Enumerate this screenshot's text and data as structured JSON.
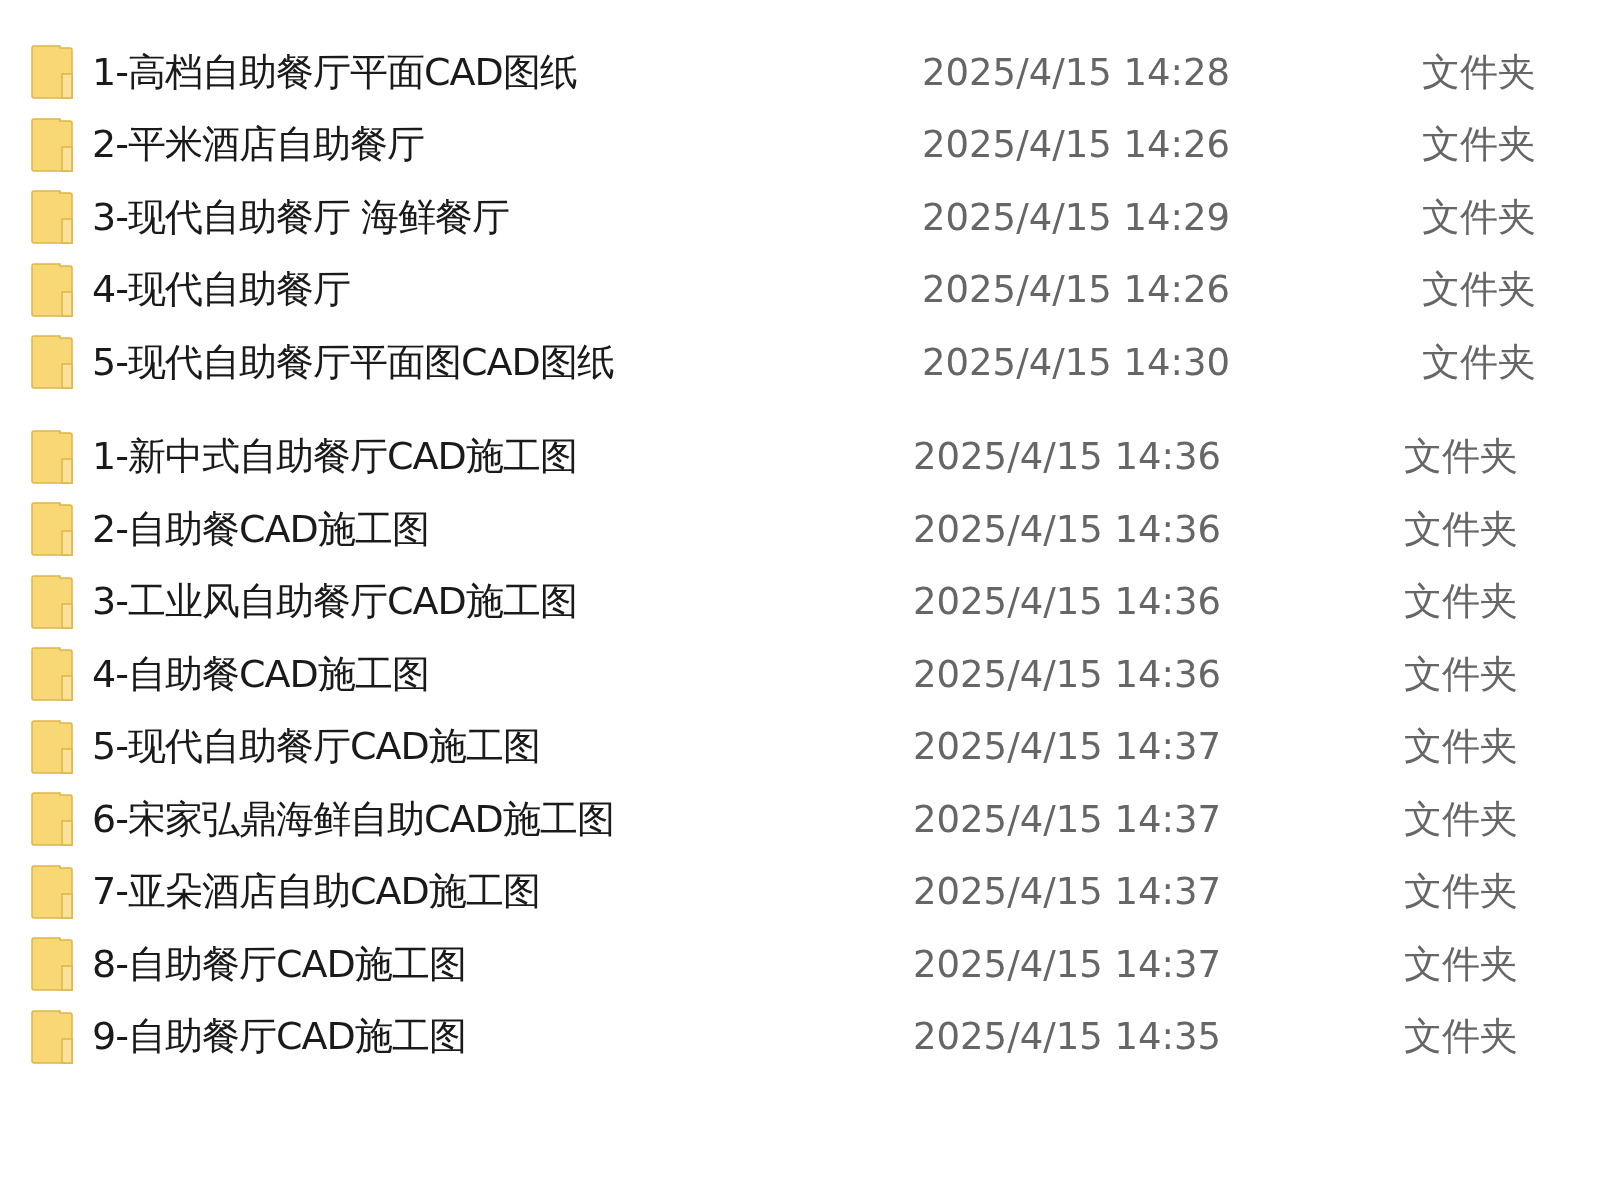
{
  "groups": [
    {
      "rows": [
        {
          "name": "1-高档自助餐厅平面CAD图纸",
          "date": "2025/4/15 14:28",
          "type": "文件夹"
        },
        {
          "name": "2-平米酒店自助餐厅",
          "date": "2025/4/15 14:26",
          "type": "文件夹"
        },
        {
          "name": "3-现代自助餐厅 海鲜餐厅",
          "date": "2025/4/15 14:29",
          "type": "文件夹"
        },
        {
          "name": "4-现代自助餐厅",
          "date": "2025/4/15 14:26",
          "type": "文件夹"
        },
        {
          "name": "5-现代自助餐厅平面图CAD图纸",
          "date": "2025/4/15 14:30",
          "type": "文件夹"
        }
      ]
    },
    {
      "rows": [
        {
          "name": "1-新中式自助餐厅CAD施工图",
          "date": "2025/4/15 14:36",
          "type": "文件夹"
        },
        {
          "name": "2-自助餐CAD施工图",
          "date": "2025/4/15 14:36",
          "type": "文件夹"
        },
        {
          "name": "3-工业风自助餐厅CAD施工图",
          "date": "2025/4/15 14:36",
          "type": "文件夹"
        },
        {
          "name": "4-自助餐CAD施工图",
          "date": "2025/4/15 14:36",
          "type": "文件夹"
        },
        {
          "name": "5-现代自助餐厅CAD施工图",
          "date": "2025/4/15 14:37",
          "type": "文件夹"
        },
        {
          "name": "6-宋家弘鼎海鲜自助CAD施工图",
          "date": "2025/4/15 14:37",
          "type": "文件夹"
        },
        {
          "name": "7-亚朵酒店自助CAD施工图",
          "date": "2025/4/15 14:37",
          "type": "文件夹"
        },
        {
          "name": "8-自助餐厅CAD施工图",
          "date": "2025/4/15 14:37",
          "type": "文件夹"
        },
        {
          "name": "9-自助餐厅CAD施工图",
          "date": "2025/4/15 14:35",
          "type": "文件夹"
        }
      ]
    }
  ]
}
